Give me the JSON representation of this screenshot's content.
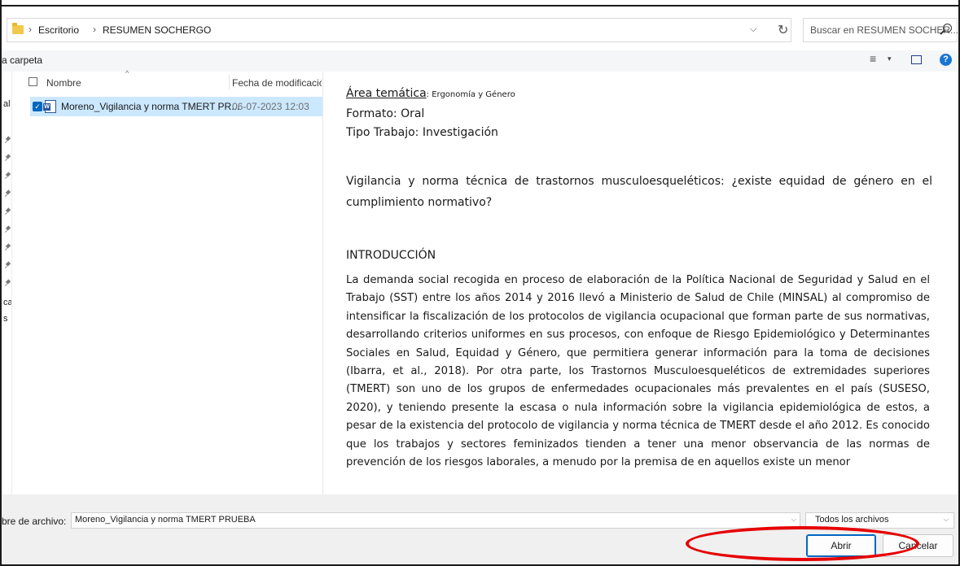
{
  "address": {
    "breadcrumb": [
      "Escritorio",
      "RESUMEN SOCHERGO"
    ],
    "separator": "›",
    "dropdown_glyph": "⌵",
    "refresh_glyph": "↻",
    "search_placeholder": "Buscar en RESUMEN SOCHER..."
  },
  "toolbar": {
    "new_folder_label": "a carpeta",
    "views_glyph": "≡",
    "caret_glyph": "▾",
    "help_glyph": "?"
  },
  "nav": {
    "texts": [
      "al",
      "cas",
      "s"
    ]
  },
  "file_list": {
    "columns": {
      "name": "Nombre",
      "date": "Fecha de modificación"
    },
    "sort_glyph": "^",
    "check_glyph": "✓",
    "files": [
      {
        "name": "Moreno_Vigilancia y norma TMERT PR...",
        "date": "06-07-2023 12:03",
        "icon": "word-doc-icon",
        "selected": true
      }
    ]
  },
  "preview": {
    "area_label": "Área temática",
    "area_value": ": Ergonomía y Género",
    "formato": "Formato: Oral",
    "tipo": "Tipo Trabajo: Investigación",
    "title": "Vigilancia y norma técnica de trastornos musculoesqueléticos: ¿existe equidad de género en el cumplimiento normativo?",
    "heading": "INTRODUCCIÓN",
    "body": "La demanda social recogida en proceso de elaboración de la Política Nacional de Seguridad y Salud en el Trabajo (SST) entre los años 2014 y 2016 llevó a Ministerio de Salud de Chile (MINSAL) al compromiso de intensificar la fiscalización de los protocolos de vigilancia ocupacional que forman parte de sus normativas, desarrollando criterios uniformes en sus procesos, con enfoque de Riesgo Epidemiológico y Determinantes Sociales en Salud, Equidad y Género, que permitiera generar información para la toma de decisiones (Ibarra, et al., 2018). Por otra parte, los Trastornos Musculoesqueléticos de extremidades superiores (TMERT) son uno de los grupos de enfermedades ocupacionales más prevalentes en el país (SUSESO, 2020), y teniendo presente la escasa o nula información sobre la vigilancia epidemiológica de estos, a pesar de la existencia del protocolo de vigilancia y norma técnica de TMERT desde el año 2012. Es conocido que los trabajos y sectores feminizados tienden a tener una menor observancia de las normas de prevención de los riesgos laborales, a menudo por la premisa de en aquellos existe un menor"
  },
  "bottom": {
    "filename_label": "bre de archivo:",
    "filename_value": "Moreno_Vigilancia y norma TMERT PRUEBA",
    "filetype_value": "Todos los archivos",
    "dropdown_glyph": "⌵",
    "open_label": "Abrir",
    "cancel_label": "Cancelar"
  },
  "colors": {
    "selection": "#cce8ff",
    "accent": "#0067c0",
    "annotation": "#e60000"
  }
}
